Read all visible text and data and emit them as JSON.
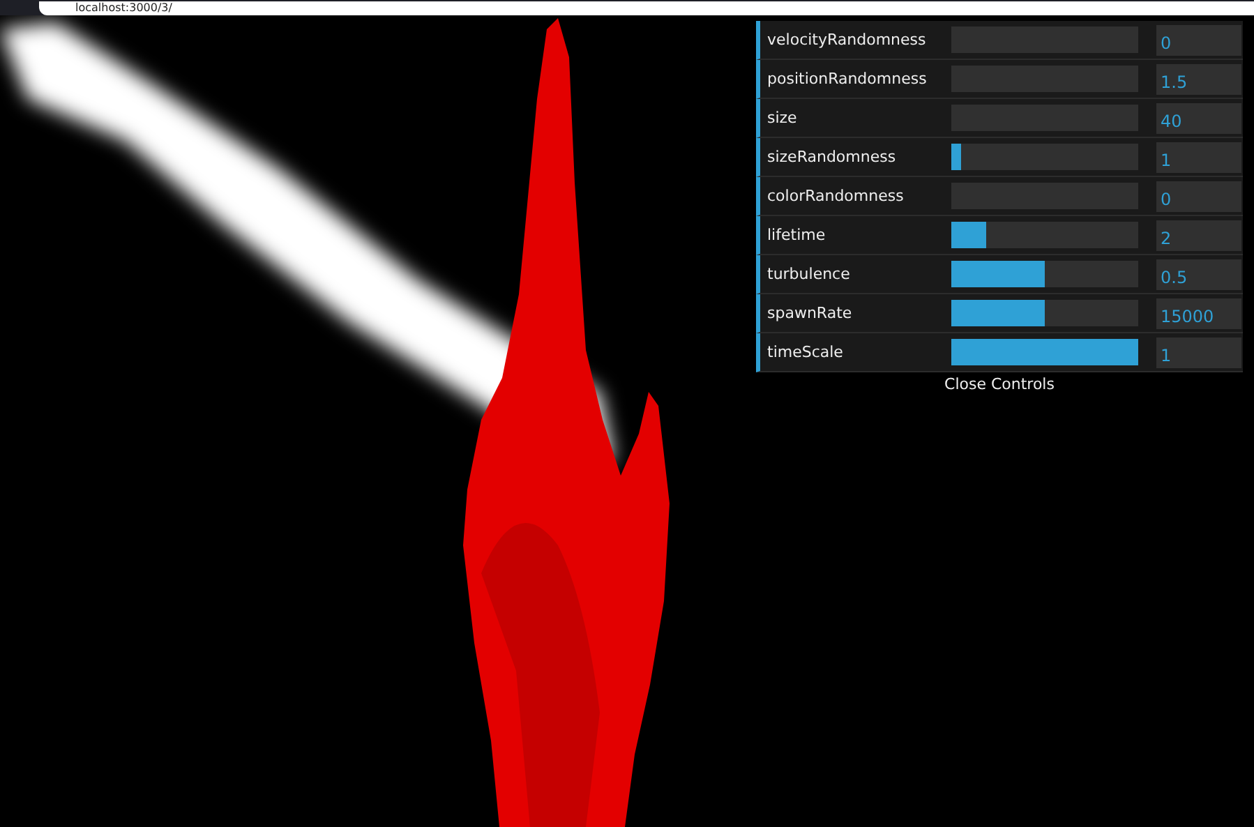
{
  "browser": {
    "address": "localhost:3000/3/"
  },
  "controls": [
    {
      "name": "velocityRandomness",
      "level": 0,
      "value": "0"
    },
    {
      "name": "positionRandomness",
      "level": 0,
      "value": "1.5"
    },
    {
      "name": "size",
      "level": 0,
      "value": "40"
    },
    {
      "name": "sizeRandomness",
      "level": 0.05,
      "value": "1"
    },
    {
      "name": "colorRandomness",
      "level": 0,
      "value": "0"
    },
    {
      "name": "lifetime",
      "level": 0.19,
      "value": "2"
    },
    {
      "name": "turbulence",
      "level": 0.5,
      "value": "0.5"
    },
    {
      "name": "spawnRate",
      "level": 0.5,
      "value": "15000"
    },
    {
      "name": "timeScale",
      "level": 1,
      "value": "1"
    }
  ],
  "close_button": "Close Controls"
}
